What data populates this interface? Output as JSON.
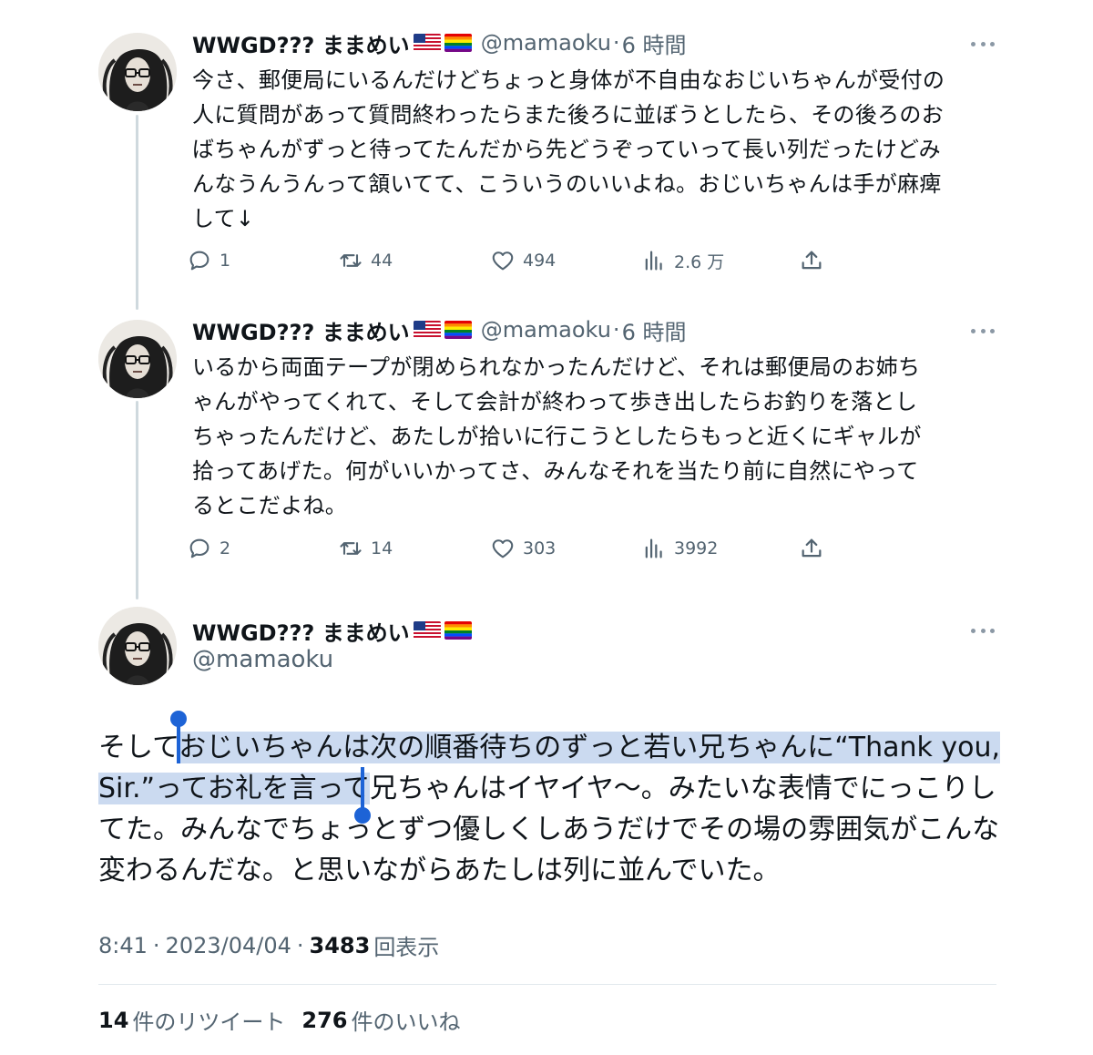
{
  "tweets": [
    {
      "author_name": "WWGD??? ままめい",
      "handle": "@mamaoku",
      "time": "6 時間",
      "lines": [
        "今さ、郵便局にいるんだけどちょっと身体が不自由なおじいちゃんが受付の",
        "人に質問があって質問終わったらまた後ろに並ぼうとしたら、その後ろのお",
        "ばちゃんがずっと待ってたんだから先どうぞっていって長い列だったけどみ",
        "んなうんうんって頷いてて、こういうのいいよね。おじいちゃんは手が麻痺",
        "して↓"
      ],
      "replies": "1",
      "retweets": "44",
      "likes": "494",
      "views": "2.6 万"
    },
    {
      "author_name": "WWGD??? ままめい",
      "handle": "@mamaoku",
      "time": "6 時間",
      "lines": [
        "いるから両面テープが閉められなかったんだけど、それは郵便局のお姉ち",
        "ゃんがやってくれて、そして会計が終わって歩き出したらお釣りを落とし",
        "ちゃったんだけど、あたしが拾いに行こうとしたらもっと近くにギャルが",
        "拾ってあげた。何がいいかってさ、みんなそれを当たり前に自然にやって",
        "るとこだよね。"
      ],
      "replies": "2",
      "retweets": "14",
      "likes": "303",
      "views": "3992"
    }
  ],
  "main_tweet": {
    "author_name": "WWGD??? ままめい",
    "handle": "@mamaoku",
    "line1_before": "そして",
    "line1_selected": "おじいちゃんは次の順番待ちのずっと若い兄ちゃんに“Thank you,",
    "line2_selected": "Sir.”ってお礼を言って",
    "line2_after": "兄ちゃんはイヤイヤ〜。みたいな表情でにっこりし",
    "line3": "てた。みんなでちょっとずつ優しくしあうだけでその場の雰囲気がこんな",
    "line4": "変わるんだな。と思いながらあたしは列に並んでいた。",
    "time": "8:41",
    "date": "2023/04/04",
    "views_count": "3483",
    "views_label": "回表示",
    "retweets_count": "14",
    "retweets_label": "件のリツイート",
    "likes_count": "276",
    "likes_label": "件のいいね"
  },
  "icons": {
    "reply": "reply-icon",
    "retweet": "retweet-icon",
    "like": "heart-icon",
    "views": "views-icon",
    "share": "share-icon",
    "more": "more-icon",
    "flag_us": "us-flag-icon",
    "flag_rainbow": "rainbow-flag-icon"
  },
  "colors": {
    "text": "#0f1419",
    "muted": "#536471",
    "selection": "#cbdaf0",
    "caret": "#1d63d6"
  }
}
